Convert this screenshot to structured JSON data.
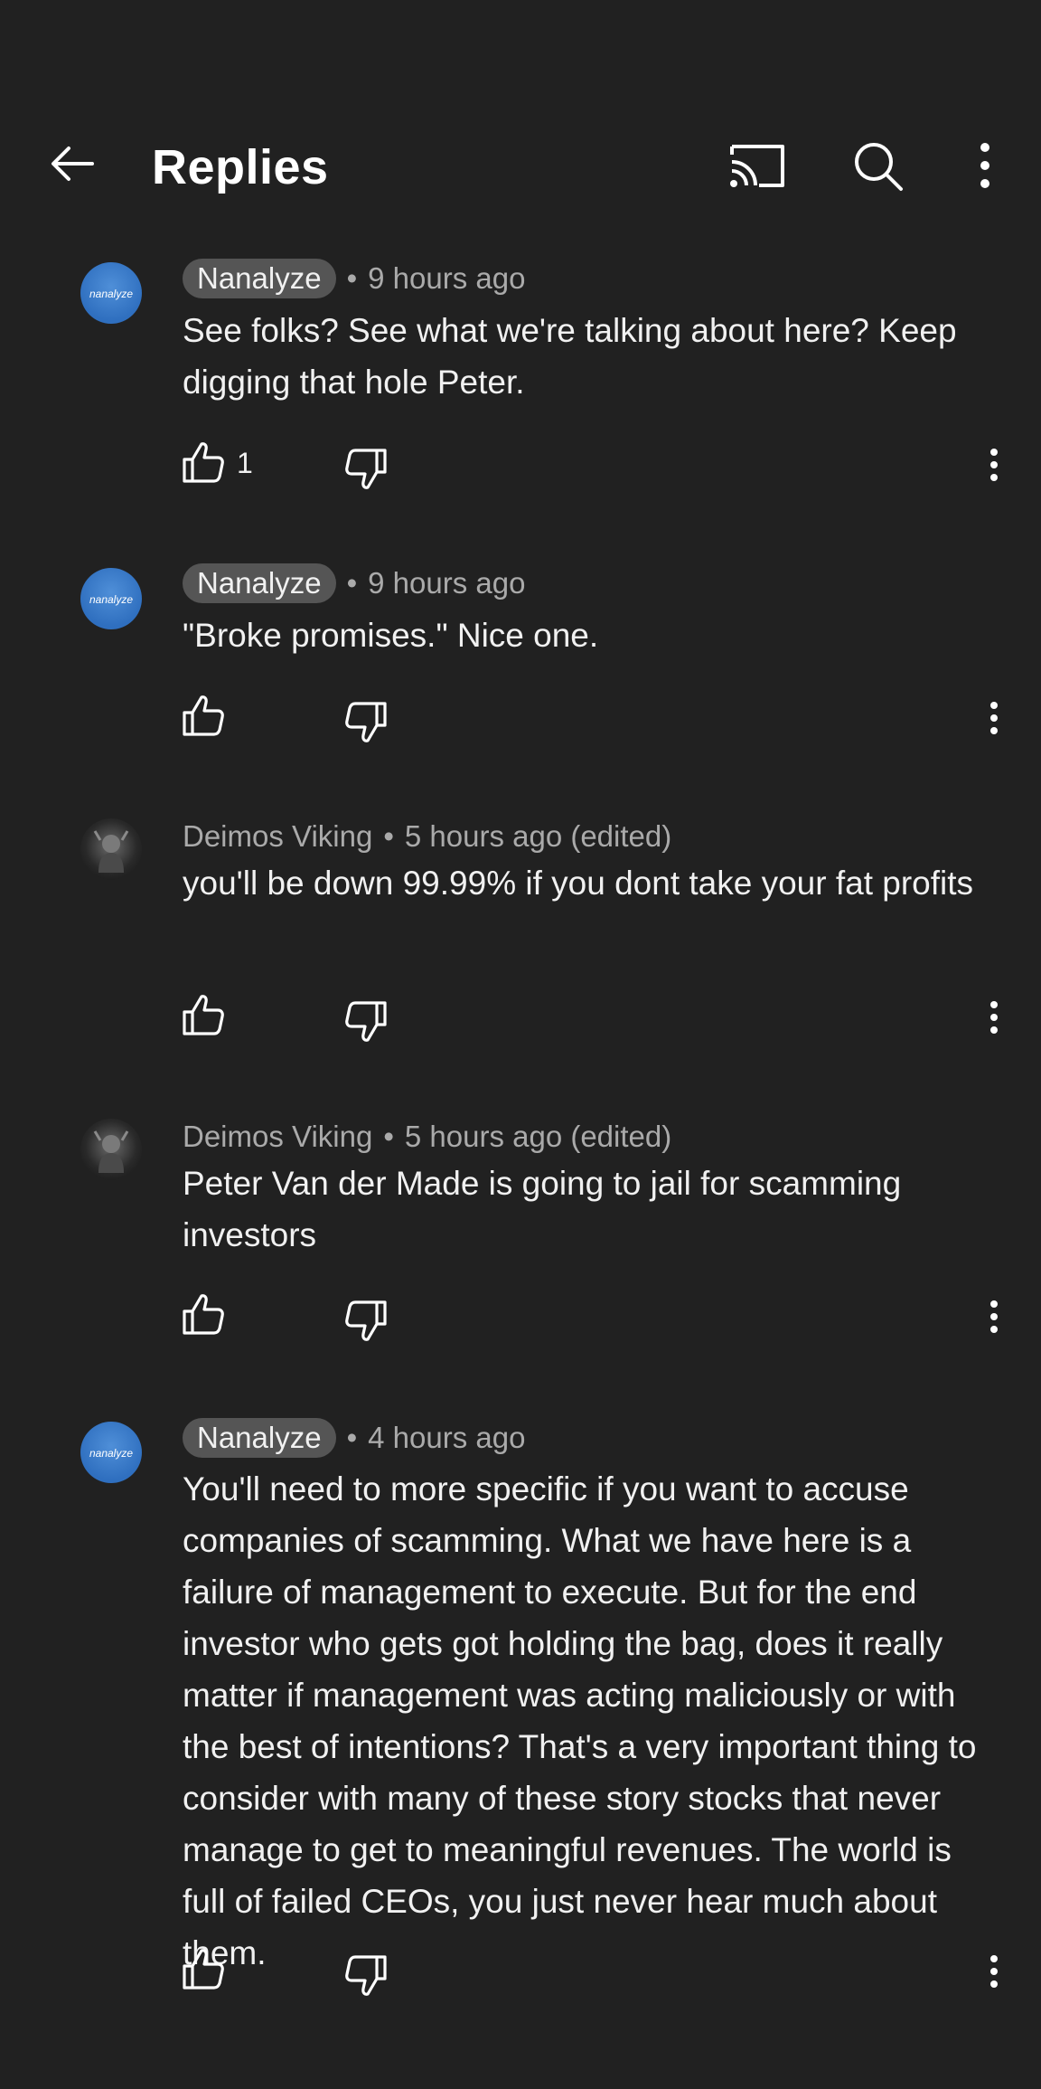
{
  "header": {
    "title": "Replies",
    "icons": [
      "back-arrow-icon",
      "cast-icon",
      "search-icon",
      "more-vert-icon"
    ]
  },
  "colors": {
    "background": "#212121",
    "text": "#f1f1f1",
    "meta": "#aaaaaa",
    "badge": "#555555",
    "avatar_nanalyze": "#2f6fbf"
  },
  "comments": [
    {
      "author": "Nanalyze",
      "author_is_creator": true,
      "avatar_label": "nanalyze",
      "separator": "•",
      "time": "9 hours ago",
      "text": "See folks? See what we're talking about here? Keep digging that hole Peter.",
      "likes": "1"
    },
    {
      "author": "Nanalyze",
      "author_is_creator": true,
      "avatar_label": "nanalyze",
      "separator": "•",
      "time": "9 hours ago",
      "text": "\"Broke promises.\" Nice one.",
      "likes": ""
    },
    {
      "author": "Deimos Viking",
      "author_is_creator": false,
      "avatar_label": "",
      "separator": "•",
      "time": "5 hours ago (edited)",
      "text": "you'll be down 99.99% if you dont take your fat profits",
      "likes": ""
    },
    {
      "author": "Deimos Viking",
      "author_is_creator": false,
      "avatar_label": "",
      "separator": "•",
      "time": "5 hours ago (edited)",
      "text": "Peter Van der Made is going to jail for scamming investors",
      "likes": ""
    },
    {
      "author": "Nanalyze",
      "author_is_creator": true,
      "avatar_label": "nanalyze",
      "separator": "•",
      "time": "4 hours ago",
      "text": "You'll need to more specific if you want to accuse companies of scamming. What we have here is a failure of management to execute. But for the end investor who gets got holding the bag, does it really matter if management was acting maliciously or with the best of intentions? That's a very important thing to consider with many of these story stocks that never manage to get to meaningful revenues. The world is full of failed CEOs, you just never hear much about them.",
      "likes": ""
    }
  ]
}
